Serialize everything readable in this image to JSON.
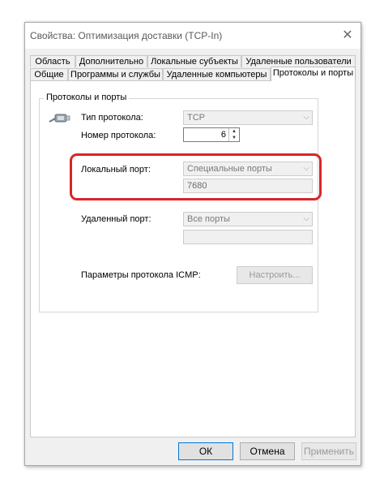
{
  "window": {
    "title": "Свойства: Оптимизация доставки (TCP-In)",
    "close": "✕"
  },
  "tabs_row1": [
    "Область",
    "Дополнительно",
    "Локальные субъекты",
    "Удаленные пользователи"
  ],
  "tabs_row2": [
    "Общие",
    "Программы и службы",
    "Удаленные компьютеры",
    "Протоколы и порты"
  ],
  "active_tab": "Протоколы и порты",
  "group": {
    "label": "Протоколы и порты"
  },
  "protocol": {
    "type_label": "Тип протокола:",
    "type_value": "TCP",
    "number_label": "Номер протокола:",
    "number_value": "6"
  },
  "local_port": {
    "label": "Локальный порт:",
    "select_value": "Специальные порты",
    "port_value": "7680"
  },
  "remote_port": {
    "label": "Удаленный порт:",
    "select_value": "Все порты",
    "port_value": ""
  },
  "icmp": {
    "label": "Параметры протокола ICMP:",
    "button": "Настроить..."
  },
  "buttons": {
    "ok": "ОК",
    "cancel": "Отмена",
    "apply": "Применить"
  },
  "colors": {
    "highlight": "#d7262a",
    "accent": "#0078d7"
  },
  "icons": {
    "protocol": "network-cable-icon",
    "chevron": "chevron-down-icon"
  }
}
